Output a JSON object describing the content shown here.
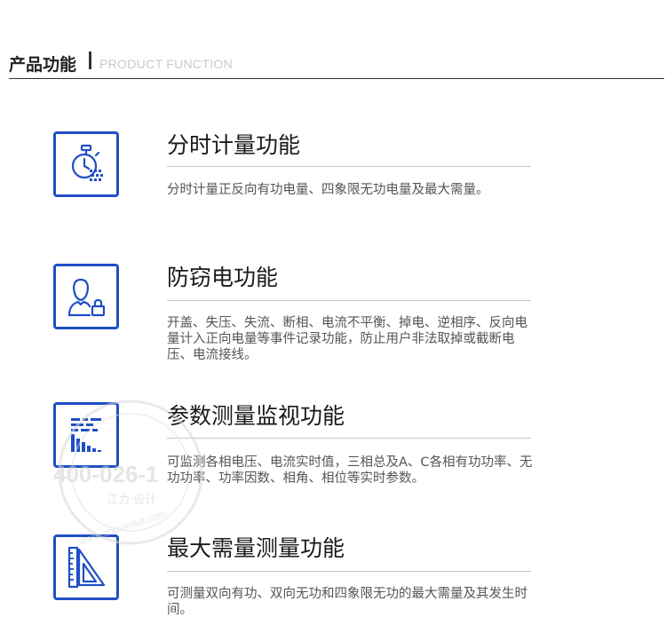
{
  "header": {
    "title_cn": "产品功能",
    "title_en": "PRODUCT FUNCTION"
  },
  "features": [
    {
      "title": "分时计量功能",
      "description": "分时计量正反向有功电量、四象限无功电量及最大需量。",
      "icon": "stopwatch-icon"
    },
    {
      "title": "防窃电功能",
      "description": "开盖、失压、失流、断相、电流不平衡、掉电、逆相序、反向电量计入正向电量等事件记录功能，防止用户非法取掉或截断电压、电流接线。",
      "icon": "user-lock-icon"
    },
    {
      "title": "参数测量监视功能",
      "description": "可监测各相电压、电流实时值，三相总及A、C各相有功功率、无功功率、功率因数、相角、相位等实时参数。",
      "icon": "bar-chart-icon"
    },
    {
      "title": "最大需量测量功能",
      "description": "可测量双向有功、双向无功和四象限无功的最大需量及其发生时间。",
      "icon": "ruler-triangle-icon"
    }
  ],
  "watermark": {
    "phone": "400-026-1",
    "brand": "江力·设计",
    "url": "www.shuweike.com"
  },
  "colors": {
    "accent": "#1f4fc4",
    "divider": "#c8c8c8",
    "text": "#555555"
  }
}
